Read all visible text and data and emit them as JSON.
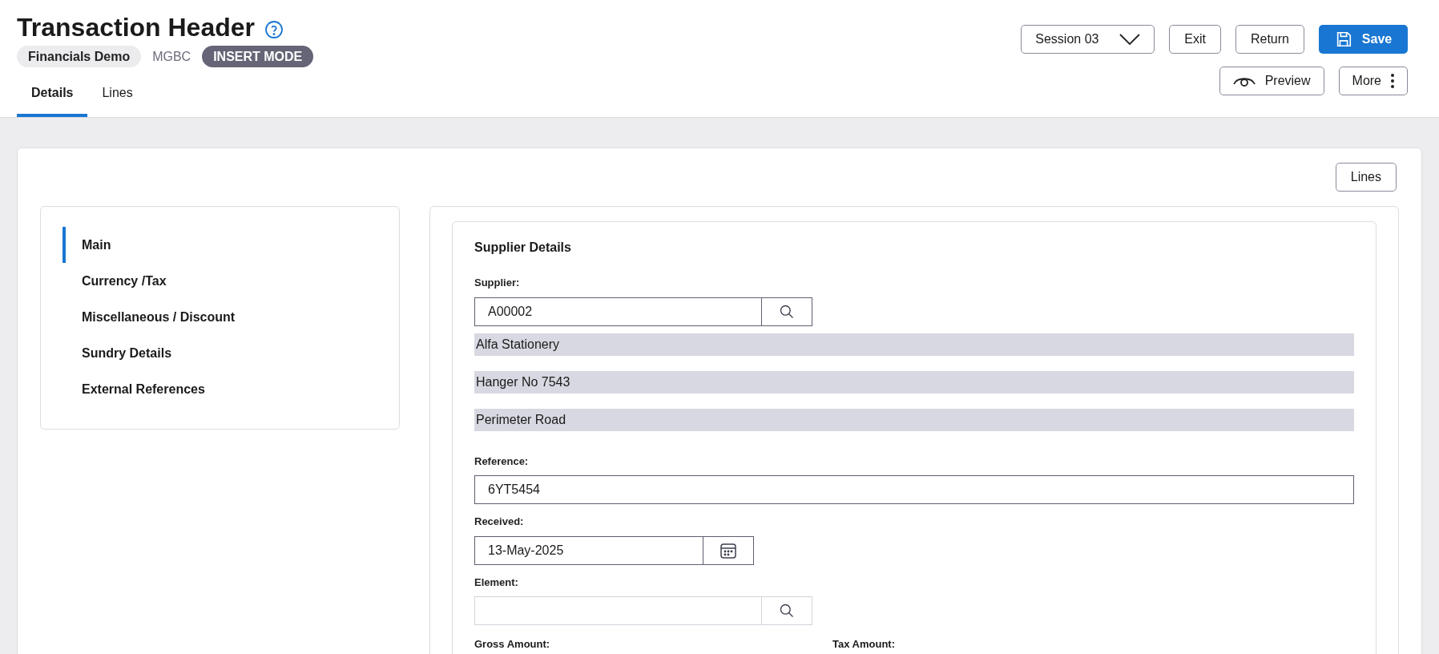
{
  "header": {
    "title": "Transaction Header",
    "badges": [
      {
        "text": "Financials Demo",
        "kind": "pill"
      },
      {
        "text": "MGBC",
        "kind": "plain"
      },
      {
        "text": "INSERT MODE",
        "kind": "mode"
      }
    ],
    "tabs": [
      {
        "label": "Details",
        "selected": true
      },
      {
        "label": "Lines",
        "selected": false
      }
    ],
    "session": "Session 03",
    "actions": [
      {
        "label": "Exit",
        "kind": "outline"
      },
      {
        "label": "Return",
        "kind": "outline"
      },
      {
        "label": "Save",
        "kind": "primary"
      }
    ],
    "secondary_actions": [
      {
        "label": "Preview",
        "kind": "preview"
      },
      {
        "label": "More",
        "kind": "more"
      }
    ]
  },
  "lines_button": "Lines",
  "nav": [
    {
      "label": "Main",
      "selected": true
    },
    {
      "label": "Currency /Tax",
      "selected": false
    },
    {
      "label": "Miscellaneous / Discount",
      "selected": false
    },
    {
      "label": "Sundry Details",
      "selected": false
    },
    {
      "label": "External References",
      "selected": false
    }
  ],
  "section": {
    "title": "Supplier Details",
    "supplier": {
      "label": "Supplier:",
      "value": "A00002"
    },
    "address": [
      "Alfa Stationery",
      "Hanger No 7543",
      "Perimeter Road"
    ],
    "reference": {
      "label": "Reference:",
      "value": "6YT5454"
    },
    "received": {
      "label": "Received:",
      "value": "13-May-2025"
    },
    "element": {
      "label": "Element:"
    },
    "gross_label": "Gross Amount:",
    "tax_label": "Tax Amount:"
  }
}
